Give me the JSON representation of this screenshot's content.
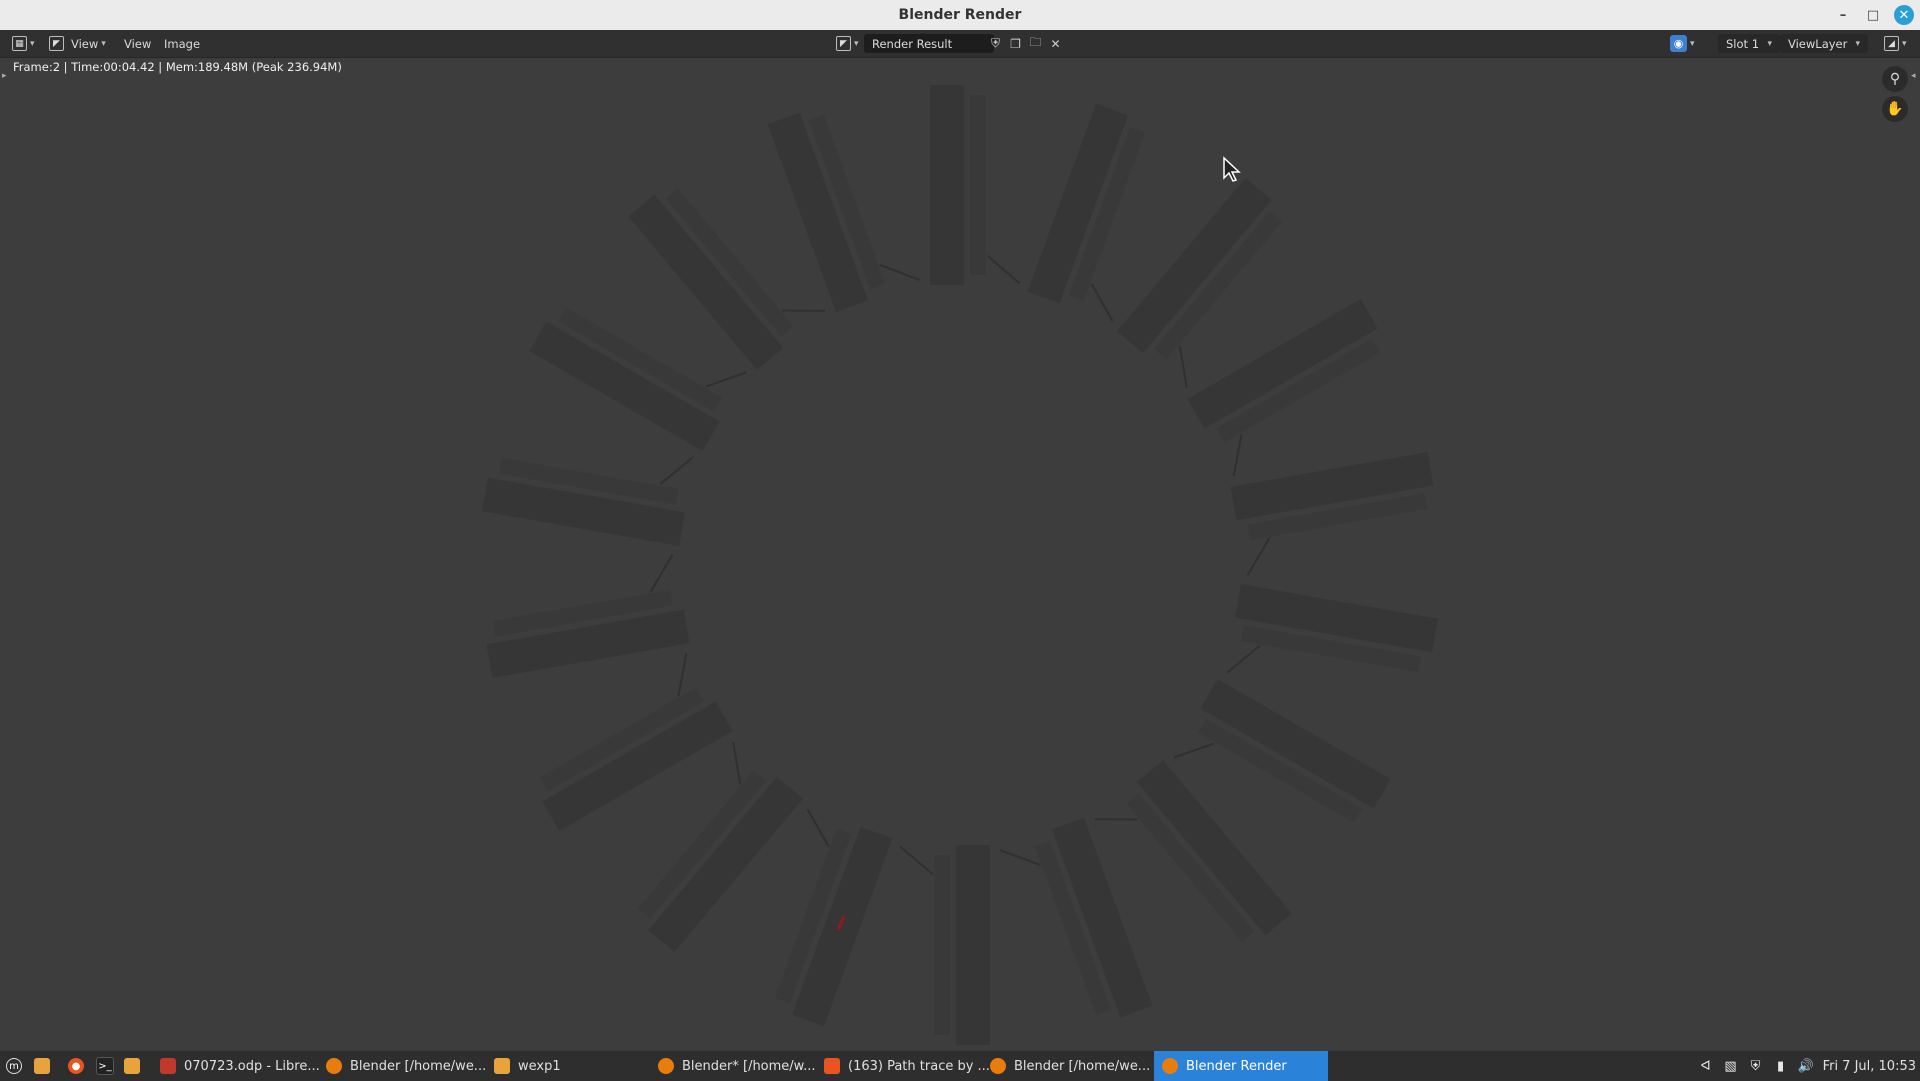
{
  "window": {
    "title": "Blender Render"
  },
  "header": {
    "view_menu": "View",
    "view2_menu": "View",
    "image_menu": "Image",
    "image_name": "Render Result",
    "slot": "Slot 1",
    "view_layer": "ViewLayer"
  },
  "viewport": {
    "info": "Frame:2 | Time:00:04.42 | Mem:189.48M (Peak 236.94M)"
  },
  "taskbar": {
    "items": [
      {
        "label": "070723.odp - Libre..."
      },
      {
        "label": "Blender [/home/we..."
      },
      {
        "label": "wexp1"
      },
      {
        "label": "Blender* [/home/w..."
      },
      {
        "label": "(163) Path trace by ..."
      },
      {
        "label": "Blender [/home/we..."
      },
      {
        "label": "Blender Render"
      }
    ],
    "clock": "Fri 7 Jul, 10:53"
  },
  "colors": {
    "accent": "#2b82d9",
    "viewport_bg": "#3d3d3d",
    "header_bg": "#303030"
  }
}
